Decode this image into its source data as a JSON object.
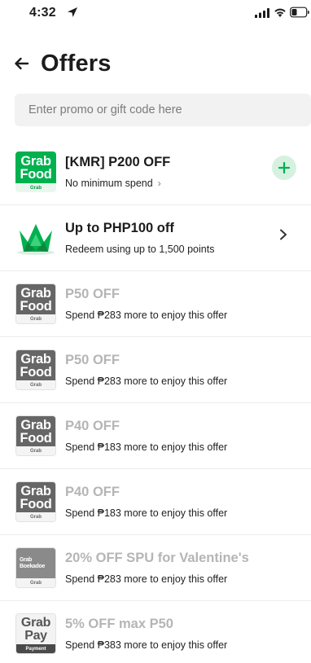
{
  "status_bar": {
    "time": "4:32"
  },
  "header": {
    "title": "Offers"
  },
  "promo": {
    "placeholder": "Enter promo or gift code here"
  },
  "offers": [
    {
      "logo": "grabfood",
      "logo_lines": [
        "Grab",
        "Food"
      ],
      "logo_strip": "Grab",
      "title": "[KMR] P200 OFF",
      "subtitle": "No minimum spend",
      "subtitle_chevron": "›",
      "action": "add",
      "enabled": true
    },
    {
      "logo": "points-crown",
      "title": "Up to PHP100 off",
      "subtitle": "Redeem using up to 1,500 points",
      "action": "chevron",
      "enabled": true
    },
    {
      "logo": "grabfood",
      "logo_lines": [
        "Grab",
        "Food"
      ],
      "logo_strip": "Grab",
      "title": "P50 OFF",
      "subtitle": "Spend ₱283 more to enjoy this offer",
      "enabled": false
    },
    {
      "logo": "grabfood",
      "logo_lines": [
        "Grab",
        "Food"
      ],
      "logo_strip": "Grab",
      "title": "P50 OFF",
      "subtitle": "Spend ₱283 more to enjoy this offer",
      "enabled": false
    },
    {
      "logo": "grabfood",
      "logo_lines": [
        "Grab",
        "Food"
      ],
      "logo_strip": "Grab",
      "title": "P40 OFF",
      "subtitle": "Spend ₱183 more to enjoy this offer",
      "enabled": false
    },
    {
      "logo": "grabfood",
      "logo_lines": [
        "Grab",
        "Food"
      ],
      "logo_strip": "Grab",
      "title": "P40 OFF",
      "subtitle": "Spend ₱183 more to enjoy this offer",
      "enabled": false
    },
    {
      "logo": "boekadoe",
      "logo_lines": [
        "Grab",
        "Boekadoe"
      ],
      "logo_strip": "Grab",
      "title": "20% OFF SPU for Valentine's",
      "subtitle": "Spend ₱283 more to enjoy this offer",
      "enabled": false
    },
    {
      "logo": "grabpay",
      "logo_lines": [
        "Grab",
        "Pay"
      ],
      "logo_strip": "Payment",
      "title": "5% OFF max P50",
      "subtitle": "Spend ₱383 more to enjoy this offer",
      "enabled": false
    }
  ],
  "colors": {
    "brand_green": "#00b14f",
    "add_bg": "#d7f1e1",
    "disabled_title": "#b5b5b5",
    "input_bg": "#f2f2f3"
  }
}
